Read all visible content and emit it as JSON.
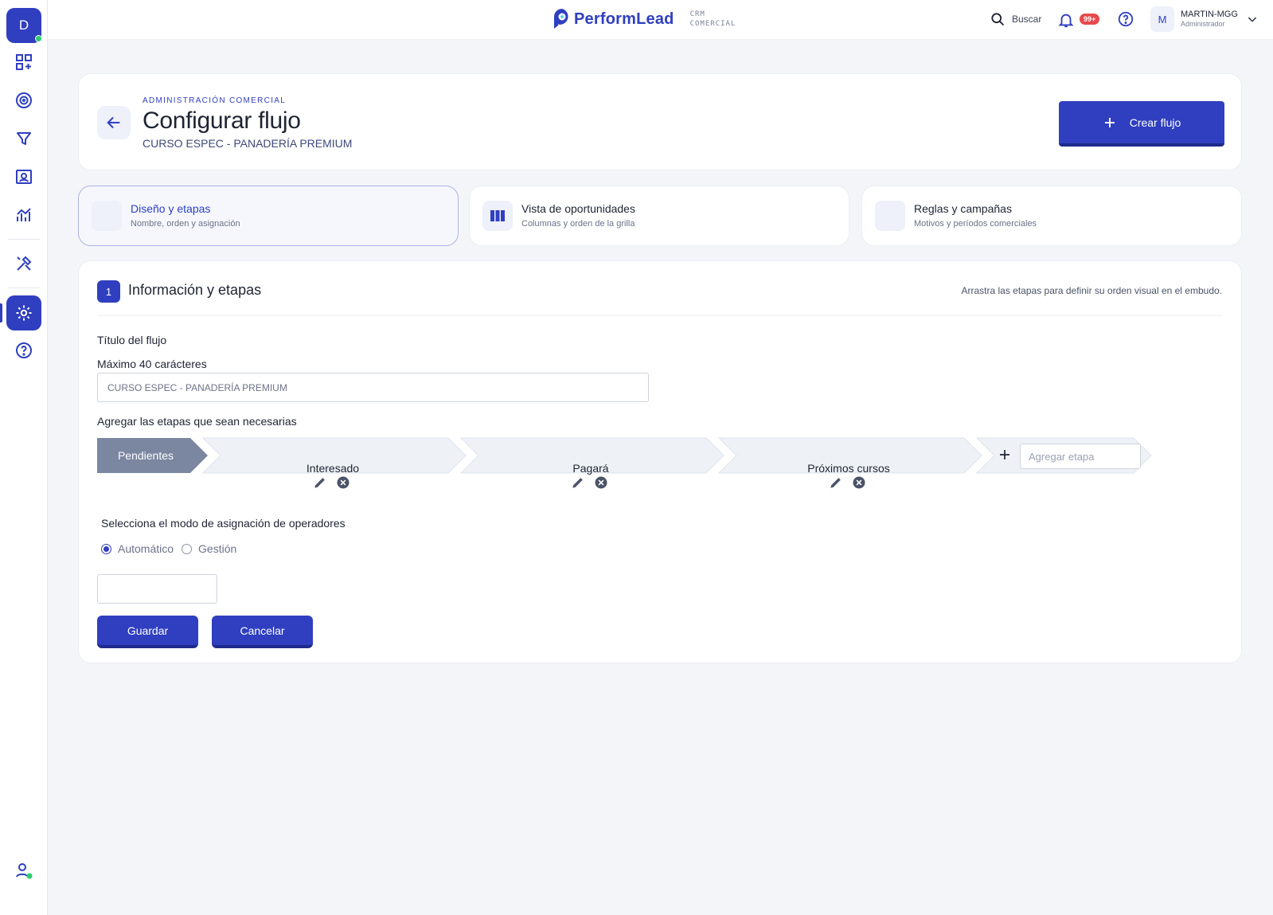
{
  "sidebar": {
    "avatar_letter": "D",
    "items": [
      {
        "icon": "dashboard-add-icon"
      },
      {
        "icon": "target-icon"
      },
      {
        "icon": "filter-funnel-icon"
      },
      {
        "icon": "contact-card-icon"
      },
      {
        "icon": "analytics-chart-icon"
      },
      {
        "icon": "tools-icon"
      },
      {
        "icon": "settings-gear-icon",
        "active": true
      },
      {
        "icon": "help-circle-icon"
      }
    ],
    "bottom_icon": "user-online-icon"
  },
  "header": {
    "brand_name": "PerformLead",
    "brand_sub_line1": "CRM",
    "brand_sub_line2": "COMERCIAL",
    "search_label": "Buscar",
    "notifications_badge": "99+",
    "user_initial": "M",
    "user_name": "MARTIN-MGG",
    "user_role": "Administrador"
  },
  "hero": {
    "eyebrow": "ADMINISTRACIÓN COMERCIAL",
    "title": "Configurar flujo",
    "subtitle": "CURSO ESPEC - PANADERÍA PREMIUM",
    "create_button": "Crear flujo"
  },
  "tabs": [
    {
      "title": "Diseño y etapas",
      "desc": "Nombre, orden y asignación"
    },
    {
      "title": "Vista de oportunidades",
      "desc": "Columnas y orden de la grilla"
    },
    {
      "title": "Reglas y campañas",
      "desc": "Motivos y períodos comerciales"
    }
  ],
  "section": {
    "step": "1",
    "title": "Información y etapas",
    "hint": "Arrastra las etapas para definir su orden visual en el embudo.",
    "flow_title_label": "Título del flujo",
    "max_chars_label": "Máximo 40 carácteres",
    "flow_title_value": "CURSO ESPEC - PANADERÍA PREMIUM",
    "stages_label": "Agregar las etapas que sean necesarias",
    "stages": [
      "Pendientes",
      "Interesado",
      "Pagará",
      "Próximos cursos"
    ],
    "add_stage_placeholder": "Agregar etapa",
    "assign_mode_label": "Selecciona el modo de asignación de operadores",
    "assign_options": [
      "Automático",
      "Gestión"
    ],
    "assign_selected": "Automático",
    "save_button": "Guardar",
    "cancel_button": "Cancelar"
  },
  "colors": {
    "accent": "#2f3fbf",
    "stage_active": "#7b86a0",
    "stage_inactive": "#eef2f7",
    "badge": "#e64a4a",
    "online": "#2ecc71"
  }
}
